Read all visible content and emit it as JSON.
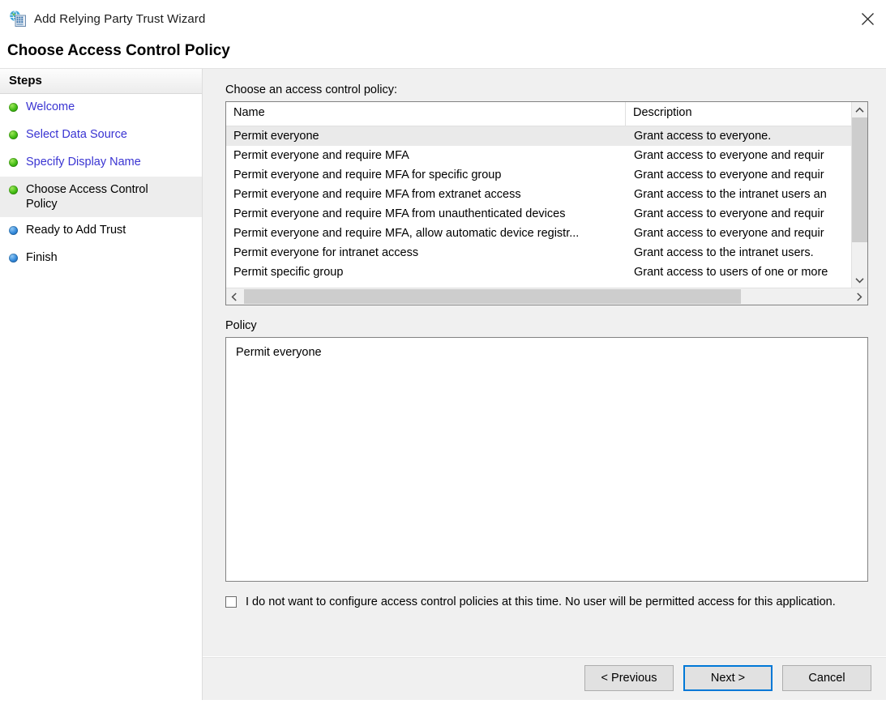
{
  "window": {
    "title": "Add Relying Party Trust Wizard",
    "icon": "relying-party-trust-icon",
    "close_icon": "close-icon"
  },
  "page": {
    "heading": "Choose Access Control Policy"
  },
  "sidebar": {
    "header": "Steps",
    "items": [
      {
        "label": "Welcome",
        "state": "completed",
        "bullet": "green"
      },
      {
        "label": "Select Data Source",
        "state": "completed",
        "bullet": "green"
      },
      {
        "label": "Specify Display Name",
        "state": "completed",
        "bullet": "green"
      },
      {
        "label": "Choose Access Control Policy",
        "state": "current",
        "bullet": "green"
      },
      {
        "label": "Ready to Add Trust",
        "state": "pending",
        "bullet": "blue"
      },
      {
        "label": "Finish",
        "state": "pending",
        "bullet": "blue"
      }
    ]
  },
  "main": {
    "list_label": "Choose an access control policy:",
    "columns": [
      "Name",
      "Description"
    ],
    "rows": [
      {
        "name": "Permit everyone",
        "description": "Grant access to everyone.",
        "selected": true
      },
      {
        "name": "Permit everyone and require MFA",
        "description": "Grant access to everyone and requir",
        "selected": false
      },
      {
        "name": "Permit everyone and require MFA for specific group",
        "description": "Grant access to everyone and requir",
        "selected": false
      },
      {
        "name": "Permit everyone and require MFA from extranet access",
        "description": "Grant access to the intranet users an",
        "selected": false
      },
      {
        "name": "Permit everyone and require MFA from unauthenticated devices",
        "description": "Grant access to everyone and requir",
        "selected": false
      },
      {
        "name": "Permit everyone and require MFA, allow automatic device registr...",
        "description": "Grant access to everyone and requir",
        "selected": false
      },
      {
        "name": "Permit everyone for intranet access",
        "description": "Grant access to the intranet users.",
        "selected": false
      },
      {
        "name": "Permit specific group",
        "description": "Grant access to users of one or more",
        "selected": false
      }
    ],
    "policy_label": "Policy",
    "policy_value": "Permit everyone",
    "checkbox": {
      "checked": false,
      "label": "I do not want to configure access control policies at this time. No user will be permitted access for this application."
    },
    "scroll_icons": {
      "up": "chevron-up-icon",
      "down": "chevron-down-icon",
      "left": "chevron-left-icon",
      "right": "chevron-right-icon"
    }
  },
  "footer": {
    "previous": "< Previous",
    "next": "Next >",
    "cancel": "Cancel"
  },
  "colors": {
    "accent": "#0078d7",
    "link": "#3a34d2",
    "completed_bullet": "#3fba12",
    "pending_bullet": "#2f86d8",
    "panel_bg": "#f0f0f0",
    "selection": "#eaeaea"
  }
}
